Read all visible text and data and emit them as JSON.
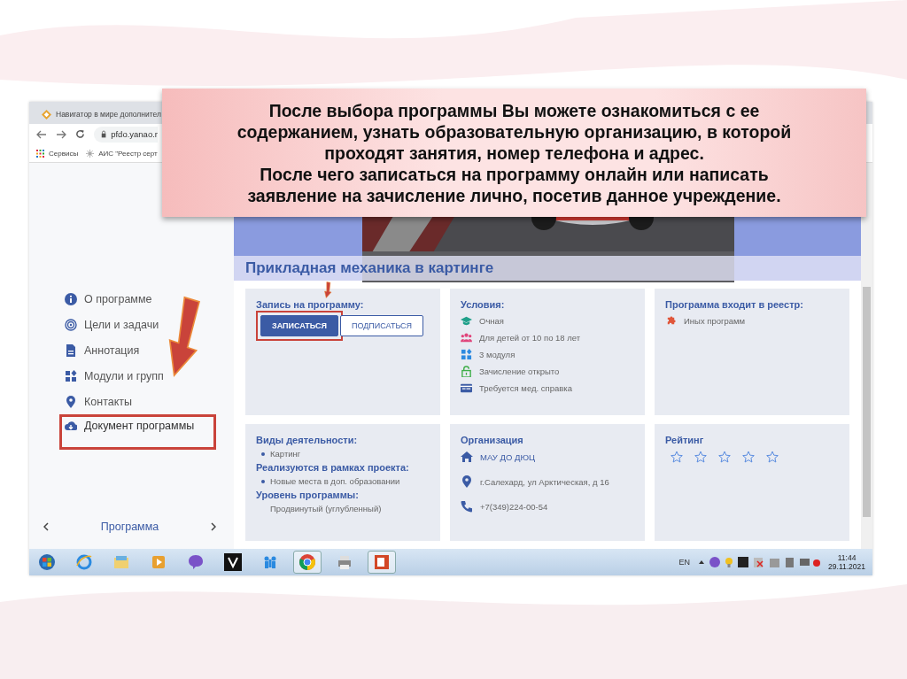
{
  "callout": {
    "paragraphs": [
      "После выбора программы Вы можете ознакомиться с ее содержанием, узнать образовательную организацию, в которой проходят занятия, номер телефона и адрес.",
      "После чего записаться на программу онлайн или написать заявление на зачисление лично, посетив данное учреждение."
    ]
  },
  "browser": {
    "tab_title": "Навигатор в мире дополнител",
    "address": "pfdo.yanao.r",
    "bookmarks": [
      "Сервисы",
      "АИС \"Реестр серт"
    ]
  },
  "sidebar": {
    "items": [
      {
        "kind": "info",
        "label": "О программе",
        "highlighted": false
      },
      {
        "kind": "target",
        "label": "Цели и задачи",
        "highlighted": false
      },
      {
        "kind": "doc",
        "label": "Аннотация",
        "highlighted": false
      },
      {
        "kind": "modules",
        "label": "Модули и групп",
        "highlighted": false
      },
      {
        "kind": "pin",
        "label": "Контакты",
        "highlighted": false
      },
      {
        "kind": "cloud",
        "label": "Документ программы",
        "highlighted": true
      }
    ],
    "nav_label": "Программа"
  },
  "program_title": "Прикладная механика в картинге",
  "cards": [
    {
      "kind": "enroll",
      "title": "Запись на программу:",
      "buttons": [
        {
          "label": "ЗАПИСАТЬСЯ",
          "primary": true,
          "highlighted": true
        },
        {
          "label": "ПОДПИСАТЬСЯ",
          "primary": false,
          "highlighted": false
        }
      ]
    },
    {
      "kind": "list",
      "title": "Условия:",
      "items": [
        {
          "kind": "cap",
          "text": "Очная"
        },
        {
          "kind": "people",
          "text": "Для детей от 10 по 18 лет"
        },
        {
          "kind": "modules",
          "text": "3 модуля"
        },
        {
          "kind": "lock",
          "text": "Зачисление открыто"
        },
        {
          "kind": "card",
          "text": "Требуется мед. справка"
        }
      ]
    },
    {
      "kind": "list",
      "title": "Программа входит в реестр:",
      "items": [
        {
          "kind": "puzzle",
          "text": "Иных программ"
        }
      ]
    },
    {
      "kind": "groups",
      "groups": [
        {
          "heading": "Виды деятельности:",
          "items": [
            {
              "text": "Картинг",
              "bullet": true
            }
          ]
        },
        {
          "heading": "Реализуются в рамках проекта:",
          "items": [
            {
              "text": "Новые места в доп. образовании",
              "bullet": true
            }
          ]
        },
        {
          "heading": "Уровень программы:",
          "items": [
            {
              "text": "Продвинутый (углубленный)",
              "bullet": false
            }
          ]
        }
      ]
    },
    {
      "kind": "org",
      "title": "Организация",
      "items": [
        {
          "kind": "home",
          "text": "МАУ ДО ДЮЦ"
        },
        {
          "kind": "pin",
          "text": "г.Салехард, ул Арктическая, д 16"
        },
        {
          "kind": "phone",
          "text": "+7(349)224-00-54"
        }
      ]
    },
    {
      "kind": "rating",
      "title": "Рейтинг",
      "stars": 0
    }
  ],
  "taskbar": {
    "language": "EN",
    "time": "11:44",
    "date": "29.11.2021"
  }
}
